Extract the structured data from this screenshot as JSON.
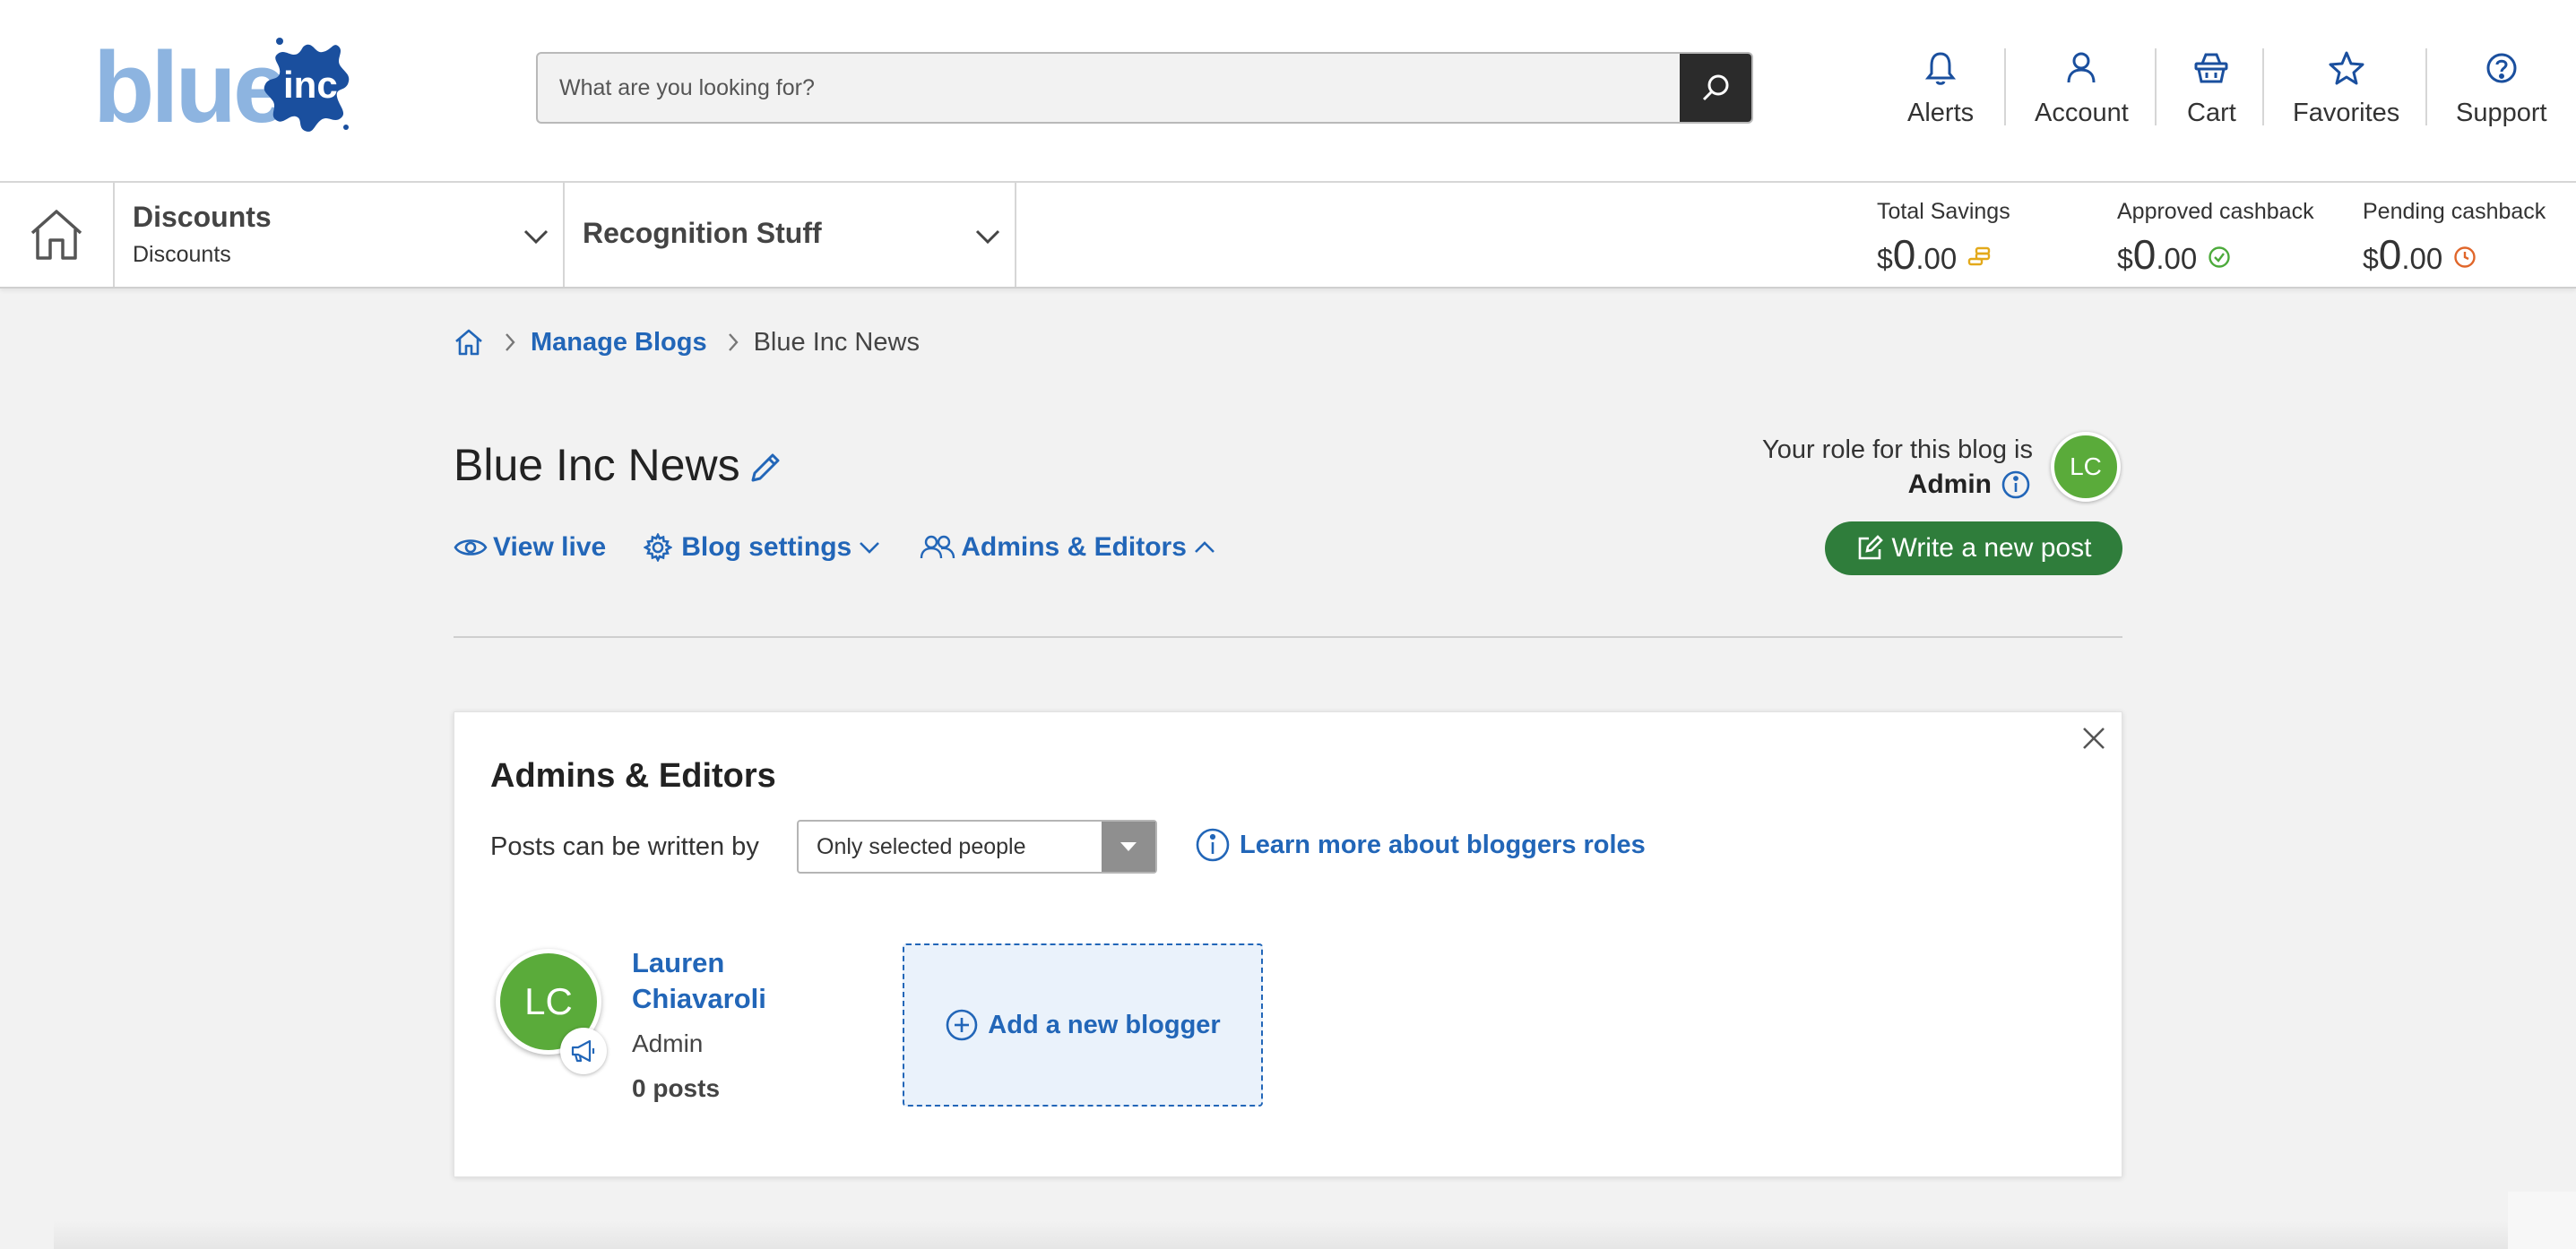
{
  "brand": {
    "logo_text": "blue",
    "logo_suffix": "inc.",
    "primary_color": "#2266b8",
    "accent_green": "#2f7d3b"
  },
  "search": {
    "placeholder": "What are you looking for?",
    "value": ""
  },
  "header_icons": [
    {
      "label": "Alerts",
      "icon": "bell-icon"
    },
    {
      "label": "Account",
      "icon": "user-icon"
    },
    {
      "label": "Cart",
      "icon": "basket-icon"
    },
    {
      "label": "Favorites",
      "icon": "star-icon"
    },
    {
      "label": "Support",
      "icon": "question-icon"
    }
  ],
  "nav": {
    "discounts": {
      "title": "Discounts",
      "subtitle": "Discounts"
    },
    "recognition": {
      "title": "Recognition Stuff"
    }
  },
  "savings": [
    {
      "label": "Total Savings",
      "currency": "$",
      "whole": "0",
      "decimal": ".00",
      "icon": "coins-icon"
    },
    {
      "label": "Approved cashback",
      "currency": "$",
      "whole": "0",
      "decimal": ".00",
      "icon": "check-circle-icon"
    },
    {
      "label": "Pending cashback",
      "currency": "$",
      "whole": "0",
      "decimal": ".00",
      "icon": "clock-icon"
    }
  ],
  "breadcrumb": {
    "link": "Manage Blogs",
    "current": "Blue Inc News"
  },
  "blog": {
    "title": "Blue Inc News",
    "role_prefix": "Your role for this blog is",
    "role": "Admin",
    "avatar_initials": "LC",
    "actions": {
      "view_live": "View live",
      "blog_settings": "Blog settings",
      "admins_editors": "Admins & Editors"
    },
    "write_post": "Write a new post"
  },
  "panel": {
    "title": "Admins & Editors",
    "posts_written_by_label": "Posts can be written by",
    "posts_written_by_value": "Only selected people",
    "learn_more": "Learn more about bloggers roles",
    "blogger": {
      "initials": "LC",
      "name": "Lauren Chiavaroli",
      "role": "Admin",
      "posts": "0 posts"
    },
    "add_blogger": "Add a new blogger"
  }
}
